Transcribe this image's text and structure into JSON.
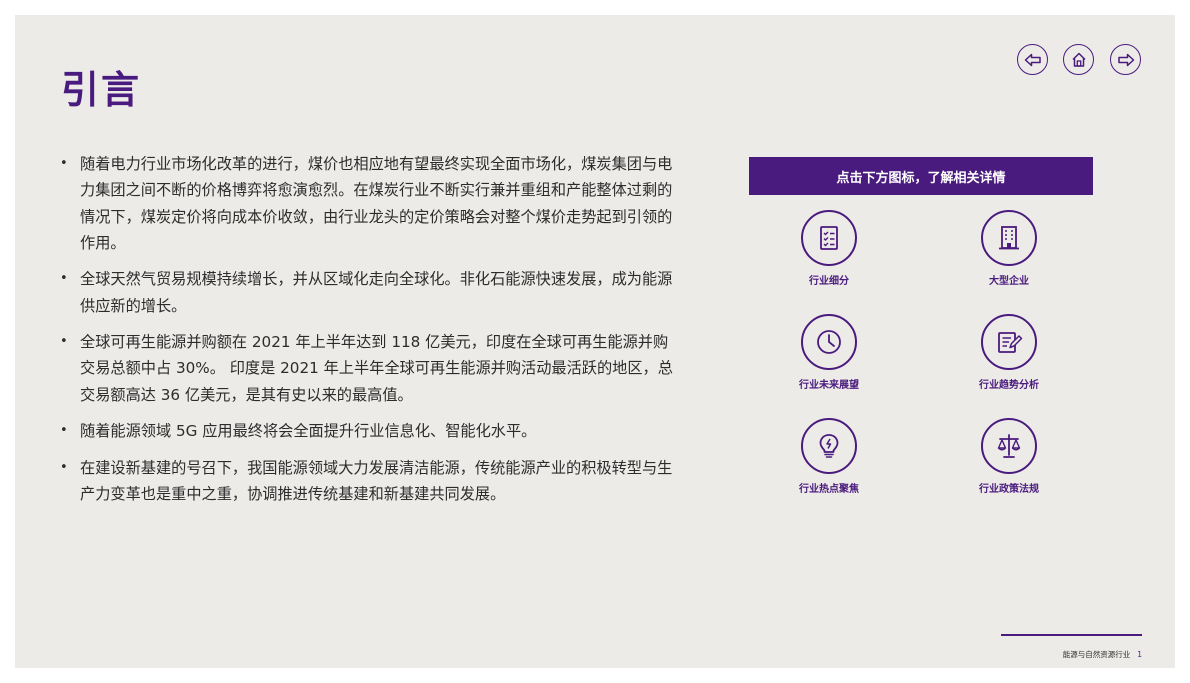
{
  "page": {
    "title": "引言"
  },
  "nav": {
    "back_icon": "left-arrow-icon",
    "home_icon": "home-icon",
    "forward_icon": "right-arrow-icon"
  },
  "bullets": [
    "随着电力行业市场化改革的进行，煤价也相应地有望最终实现全面市场化，煤炭集团与电力集团之间不断的价格博弈将愈演愈烈。在煤炭行业不断实行兼并重组和产能整体过剩的情况下，煤炭定价将向成本价收敛，由行业龙头的定价策略会对整个煤价走势起到引领的作用。",
    "全球天然气贸易规模持续增长，并从区域化走向全球化。非化石能源快速发展，成为能源供应新的增长。",
    "全球可再生能源并购额在 2021 年上半年达到 118 亿美元，印度在全球可再生能源并购交易总额中占 30%。 印度是 2021 年上半年全球可再生能源并购活动最活跃的地区，总交易额高达 36 亿美元，是其有史以来的最高值。",
    "随着能源领域 5G 应用最终将会全面提升行业信息化、智能化水平。",
    "在建设新基建的号召下，我国能源领域大力发展清洁能源，传统能源产业的积极转型与生产力变革也是重中之重，协调推进传统基建和新基建共同发展。"
  ],
  "panel": {
    "header": "点击下方图标，了解相关详情",
    "tiles": [
      {
        "label": "行业细分",
        "icon": "checklist-icon"
      },
      {
        "label": "大型企业",
        "icon": "building-icon"
      },
      {
        "label": "行业未来展望",
        "icon": "clock-icon"
      },
      {
        "label": "行业趋势分析",
        "icon": "document-edit-icon"
      },
      {
        "label": "行业热点聚焦",
        "icon": "lightbulb-icon"
      },
      {
        "label": "行业政策法规",
        "icon": "scales-icon"
      }
    ]
  },
  "footer": {
    "text": "能源与自然资源行业",
    "page_number": "1"
  },
  "colors": {
    "accent": "#4a1b7e",
    "background": "#edebe8",
    "text": "#2c2c2c"
  }
}
